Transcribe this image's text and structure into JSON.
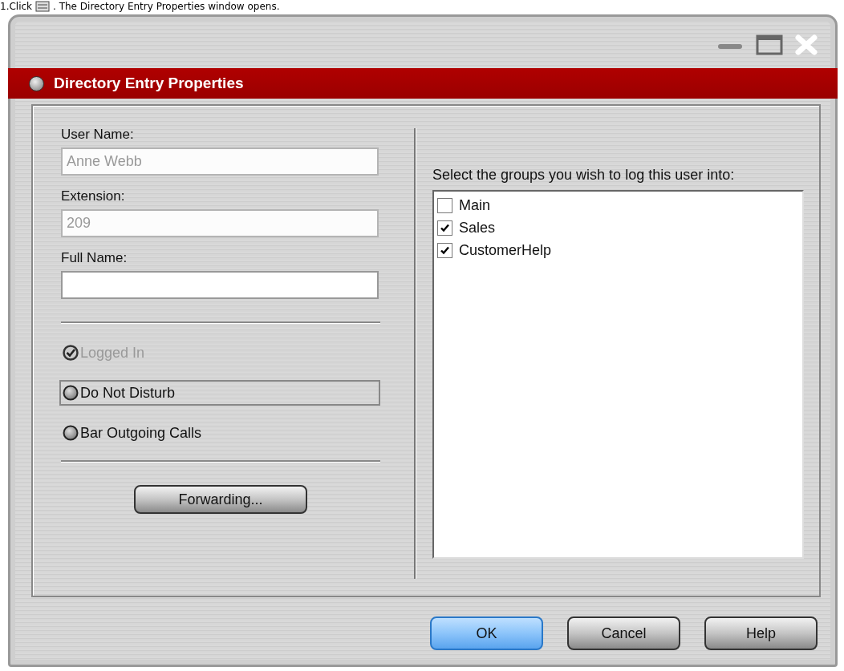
{
  "caption": {
    "before": "1.Click",
    "after": ". The Directory Entry Properties window opens."
  },
  "window": {
    "title": "Directory Entry Properties"
  },
  "fields": [
    {
      "label": "User Name:",
      "value": "Anne Webb",
      "disabled": true
    },
    {
      "label": "Extension:",
      "value": "209",
      "disabled": true
    },
    {
      "label": "Full Name:",
      "disabled": false
    }
  ],
  "options": [
    {
      "label": "Logged In",
      "checked": true,
      "disabled": true,
      "focused": false
    },
    {
      "label": "Do Not Disturb",
      "checked": false,
      "disabled": false,
      "focused": true
    },
    {
      "label": "Bar Outgoing Calls",
      "checked": false,
      "disabled": false,
      "focused": false
    }
  ],
  "forwarding_button": "Forwarding...",
  "groups": {
    "prompt": "Select the groups you wish to log this user into:",
    "items": [
      {
        "label": "Main",
        "checked": false
      },
      {
        "label": "Sales",
        "checked": true
      },
      {
        "label": "CustomerHelp",
        "checked": true
      }
    ]
  },
  "buttons": [
    {
      "label": "OK",
      "default": true
    },
    {
      "label": "Cancel",
      "default": false
    },
    {
      "label": "Help",
      "default": false
    }
  ]
}
